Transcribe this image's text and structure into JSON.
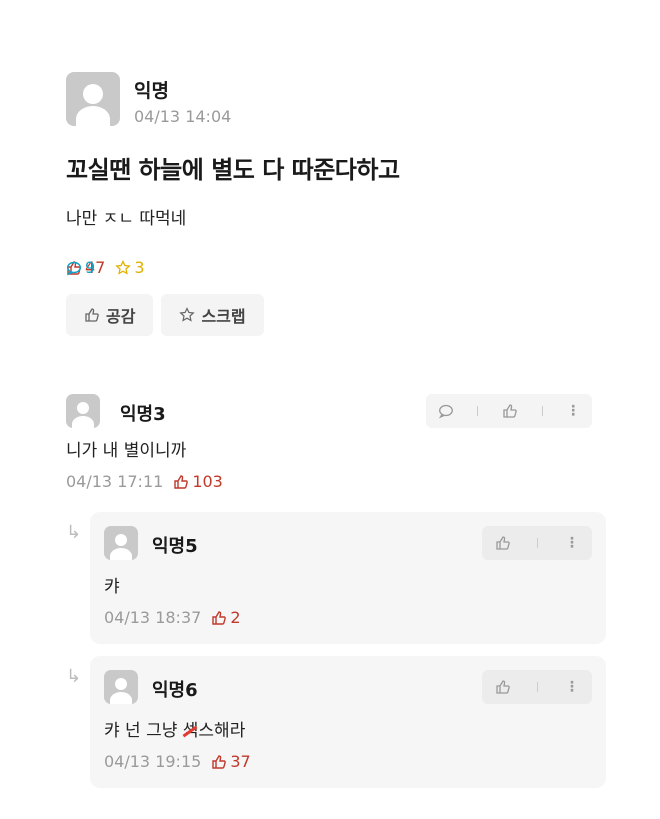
{
  "post": {
    "author": "익명",
    "date": "04/13 14:04",
    "title": "꼬실땐 하늘에 별도 다 따준다하고",
    "body": "나만 ㅈㄴ 따먹네",
    "likes": "47",
    "comments": "9",
    "scraps": "3",
    "like_button": "공감",
    "scrap_button": "스크랩"
  },
  "comments": [
    {
      "author": "익명3",
      "text": "니가 내 별이니까",
      "date": "04/13 17:11",
      "likes": "103"
    }
  ],
  "replies": [
    {
      "author": "익명5",
      "text": "캬",
      "date": "04/13 18:37",
      "likes": "2"
    },
    {
      "author": "익명6",
      "text_before": "캬 넌 그냥 ",
      "text_struck": "섹",
      "text_after": "스해라",
      "date": "04/13 19:15",
      "likes": "37"
    }
  ],
  "colors": {
    "like": "#c0392b",
    "comment": "#0fa3c7",
    "scrap": "#e0b100"
  },
  "icons": [
    "thumbs-up-icon",
    "comment-bubble-icon",
    "star-icon",
    "more-vertical-icon",
    "reply-arrow-icon"
  ]
}
